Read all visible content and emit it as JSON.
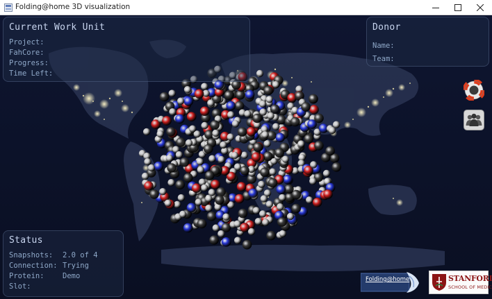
{
  "window": {
    "title": "Folding@home 3D visualization",
    "icon": "folding-app-icon",
    "buttons": [
      "minimize-icon",
      "maximize-icon",
      "close-icon"
    ]
  },
  "work_unit": {
    "title": "Current Work Unit",
    "fields": [
      {
        "label": "Project:",
        "value": ""
      },
      {
        "label": "FahCore:",
        "value": ""
      },
      {
        "label": "Progress:",
        "value": ""
      },
      {
        "label": "Time Left:",
        "value": ""
      }
    ]
  },
  "donor": {
    "title": "Donor",
    "fields": [
      {
        "label": "Name:",
        "value": ""
      },
      {
        "label": "Team:",
        "value": ""
      }
    ]
  },
  "status": {
    "title": "Status",
    "fields": [
      {
        "label": "Snapshots:",
        "value": "2.0 of 4"
      },
      {
        "label": "Connection:",
        "value": "Trying"
      },
      {
        "label": "Protein:",
        "value": "Demo"
      },
      {
        "label": "Slot:",
        "value": ""
      }
    ]
  },
  "side_buttons": [
    {
      "name": "lifebuoy-help-icon"
    },
    {
      "name": "team-people-icon"
    }
  ],
  "logos": {
    "fah": {
      "text": "Folding@home"
    },
    "stanford": {
      "name": "STANFORD",
      "subtitle": "SCHOOL OF MEDICINE"
    }
  },
  "colors": {
    "scene_bg": "#0d1226",
    "panel_text": "#8fa8c8",
    "panel_title": "#c9d6f0",
    "atom_carbon": "#3a3a3a",
    "atom_hydrogen": "#c8c8c8",
    "atom_oxygen": "#d02020",
    "atom_nitrogen": "#2838d8",
    "stanford_red": "#8c1515"
  }
}
